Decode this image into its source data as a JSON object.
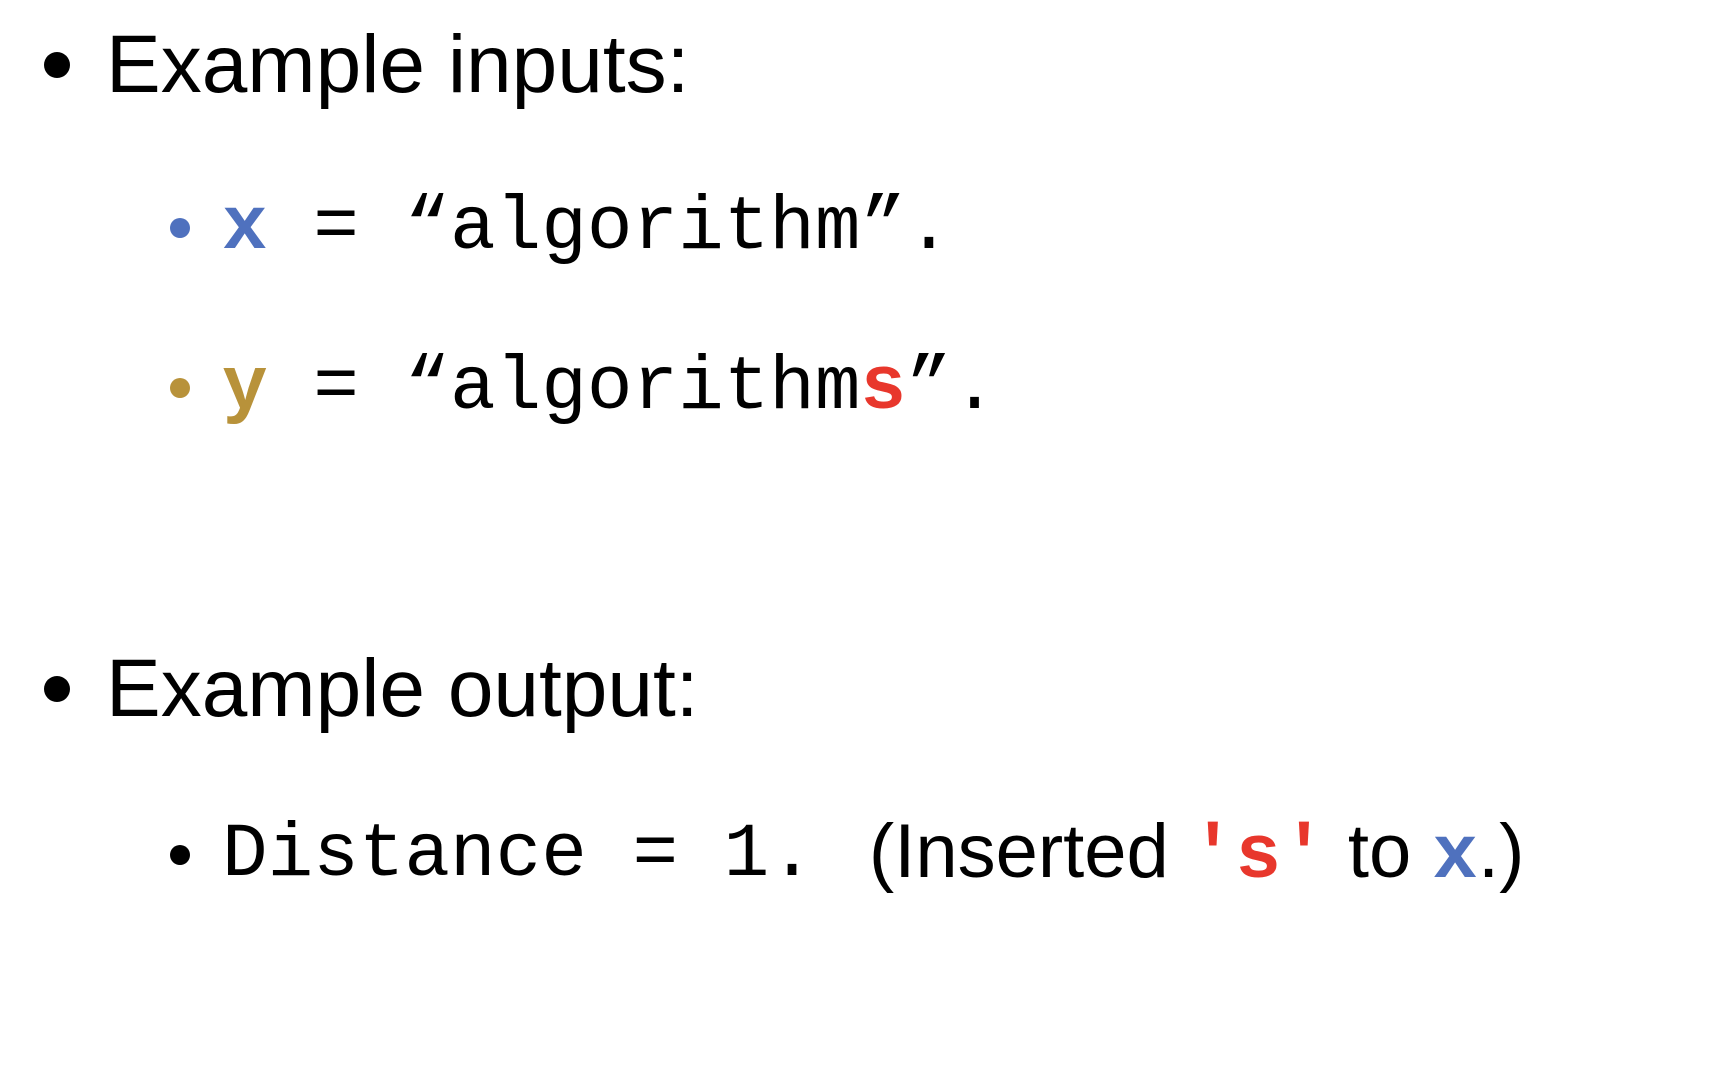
{
  "heading_inputs": "Example inputs:",
  "input_x": {
    "var": "x",
    "eq": " = ",
    "open_quote": "“",
    "value": "algorithm",
    "close_quote": "”."
  },
  "input_y": {
    "var": "y",
    "eq": " = ",
    "open_quote": "“",
    "value": "algorithm",
    "highlight": "s",
    "close_quote": "”."
  },
  "heading_output": "Example output:",
  "output": {
    "label": "Distance = 1.",
    "paren_open": "(Inserted ",
    "inserted_char": "'s'",
    "to_text": " to ",
    "var": "x",
    "paren_close": ".)"
  },
  "colors": {
    "x_var": "#4f71be",
    "y_var": "#b8923a",
    "highlight": "#e8372c"
  }
}
